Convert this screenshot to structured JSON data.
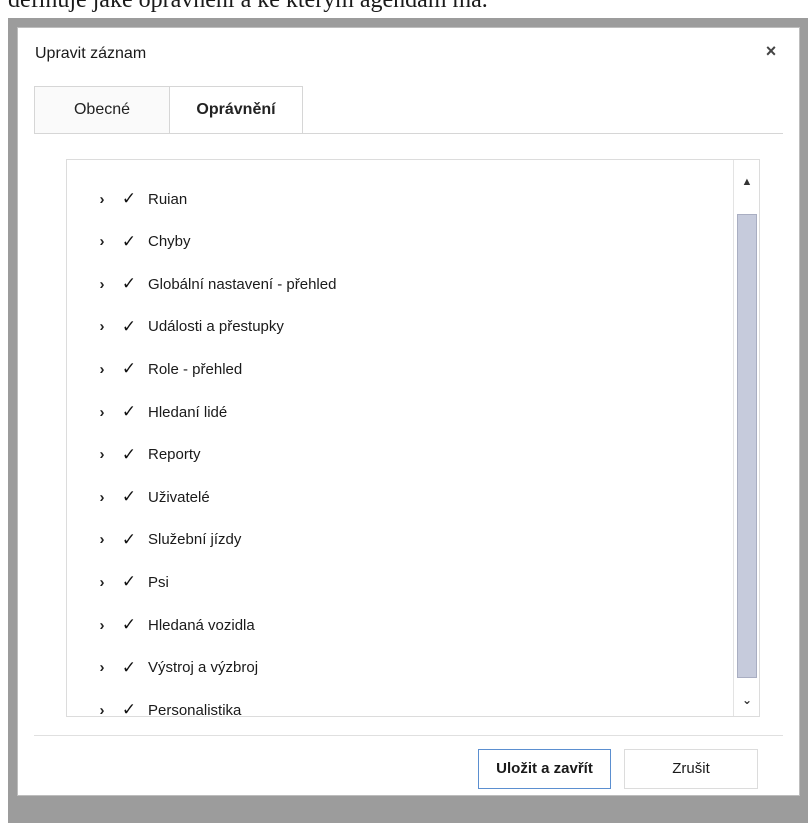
{
  "doc_text": "definuje jaké oprávnění a ke kterým agendám má.",
  "dialog": {
    "title": "Upravit záznam",
    "close_glyph": "×",
    "tabs": [
      {
        "label": "Obecné",
        "active": false
      },
      {
        "label": "Oprávnění",
        "active": true
      }
    ]
  },
  "tree": {
    "expander_glyph": "›",
    "check_glyph": "✓",
    "items": [
      {
        "label": "Ruian",
        "checked": true
      },
      {
        "label": "Chyby",
        "checked": true
      },
      {
        "label": "Globální nastavení - přehled",
        "checked": true
      },
      {
        "label": "Události a přestupky",
        "checked": true
      },
      {
        "label": "Role - přehled",
        "checked": true
      },
      {
        "label": "Hledaní lidé",
        "checked": true
      },
      {
        "label": "Reporty",
        "checked": true
      },
      {
        "label": "Uživatelé",
        "checked": true
      },
      {
        "label": "Služební jízdy",
        "checked": true
      },
      {
        "label": "Psi",
        "checked": true
      },
      {
        "label": "Hledaná vozidla",
        "checked": true
      },
      {
        "label": "Výstroj a výzbroj",
        "checked": true
      },
      {
        "label": "Personalistika",
        "checked": true
      }
    ]
  },
  "scrollbar": {
    "up_glyph": "▲",
    "down_glyph": "⌄"
  },
  "buttons": {
    "save_label": "Uložit a zavřít",
    "cancel_label": "Zrušit"
  },
  "colors": {
    "overlay": "#9c9c9c",
    "scroll_thumb": "#c6cbdc",
    "primary_border": "#5b8fd0"
  }
}
